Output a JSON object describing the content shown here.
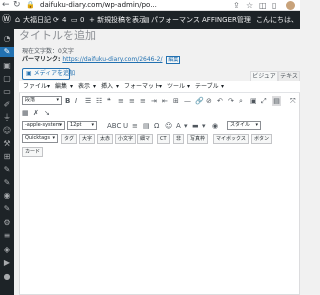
{
  "browser": {
    "url": "daifuku-diary.com/wp-admin/po..."
  },
  "admin_bar": {
    "site_name": "大福日記",
    "updates_count": "4",
    "comments_count": "0",
    "new_label": "+ 新規",
    "view_post_label": "投稿を表示",
    "performance_label": "パフォーマンス",
    "affinger_label": "AFFINGER管理",
    "greeting": "こんにちは、"
  },
  "post": {
    "title_placeholder": "タイトルを追加",
    "char_count": "現在文字数：0文字",
    "permalink_label": "パーマリンク:",
    "permalink_url": "https://daifuku-diary.com/2646-2/",
    "permalink_edit": "編集"
  },
  "editor": {
    "add_media_label": "メディアを追加",
    "tab_visual": "ビジュアル",
    "tab_text": "テキスト",
    "menu": [
      "ファイル",
      "編集",
      "表示",
      "挿入",
      "フォーマット",
      "ツール",
      "テーブル"
    ],
    "format_select": "段落",
    "font_select": "-apple-system",
    "size_select": "12pt",
    "style_select": "スタイル",
    "quicktags_select": "Quicktags",
    "quick_buttons": [
      "タグ",
      "大字",
      "太赤",
      "小文字",
      "細マ",
      "CT",
      "非",
      "写真枠",
      "マイボックス",
      "ボタン",
      "カード"
    ]
  }
}
